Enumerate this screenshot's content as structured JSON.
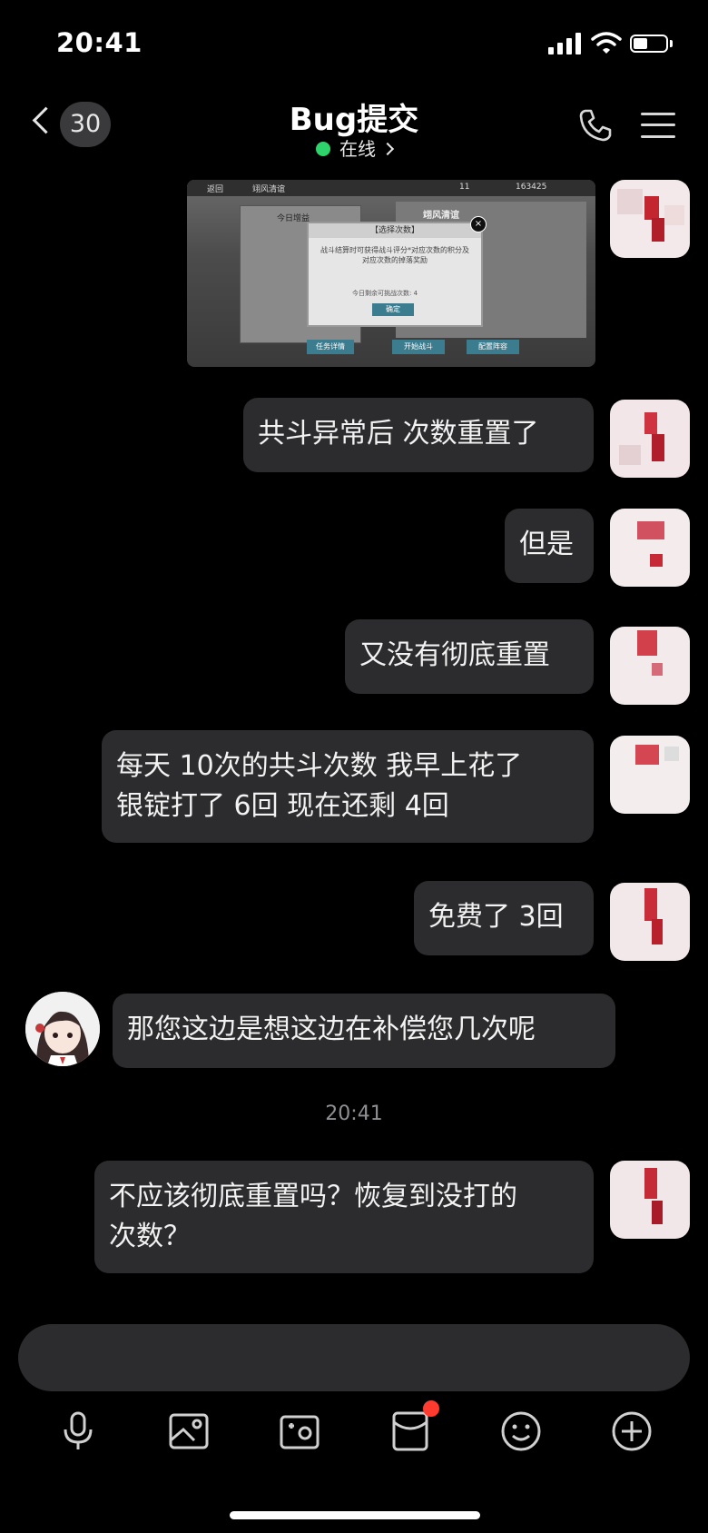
{
  "status_bar": {
    "time": "20:41",
    "battery_level": 0.45
  },
  "header": {
    "back_count": "30",
    "title": "Bug提交",
    "status": "在线"
  },
  "screenshot_message": {
    "back_label": "返回",
    "tab_label": "翊风清谊",
    "currency_1": "11",
    "currency_2": "163425",
    "left_panel_title": "今日增益",
    "right_panel_title": "翊风清谊",
    "dialog_title": "【选择次数】",
    "dialog_text": "战斗结算时可获得战斗评分*对应次数的积分及对应次数的掉落奖励",
    "dialog_remaining": "今日剩余可挑战次数: 4",
    "confirm_label": "确定",
    "task_label": "任务详情",
    "start_label": "开始战斗",
    "team_label": "配置阵容"
  },
  "messages": [
    {
      "side": "me",
      "text": "共斗异常后 次数重置了"
    },
    {
      "side": "me",
      "text": "但是"
    },
    {
      "side": "me",
      "text": "又没有彻底重置"
    },
    {
      "side": "me",
      "text_line1": "每天 10次的共斗次数  我早上花了",
      "text_line2": "银锭打了 6回  现在还剩 4回"
    },
    {
      "side": "me",
      "text": "免费了 3回"
    },
    {
      "side": "other",
      "text": "那您这边是想这边在补偿您几次呢"
    },
    {
      "side": "me",
      "text_line1": "不应该彻底重置吗？恢复到没打的",
      "text_line2": "次数？"
    }
  ],
  "timestamp": "20:41",
  "toolbar": {
    "icons": [
      "microphone-icon",
      "image-icon",
      "camera-icon",
      "red-packet-icon",
      "emoji-icon",
      "add-icon"
    ]
  },
  "colors": {
    "background": "#000000",
    "bubble": "#2c2c2e",
    "online_dot": "#2fd36c",
    "notification_dot": "#ff3b30"
  }
}
